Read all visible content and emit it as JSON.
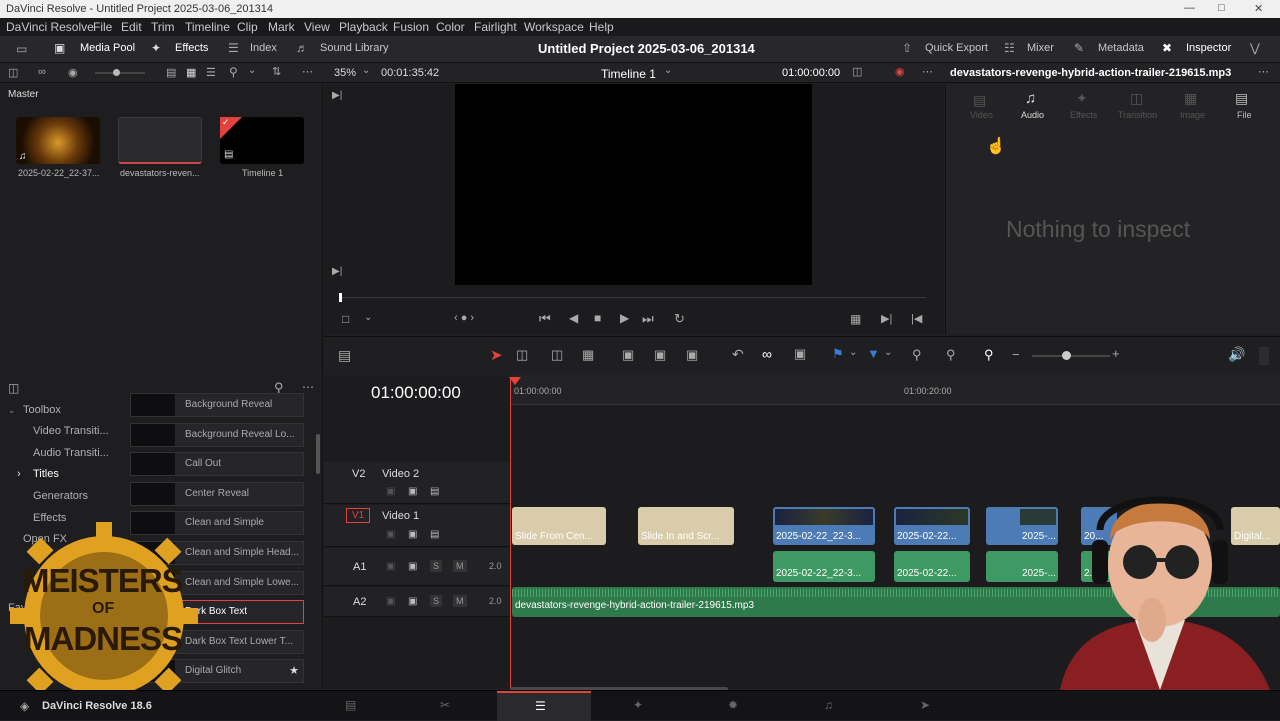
{
  "window": {
    "title": "DaVinci Resolve - Untitled Project 2025-03-06_201314"
  },
  "menu": [
    "DaVinci Resolve",
    "File",
    "Edit",
    "Trim",
    "Timeline",
    "Clip",
    "Mark",
    "View",
    "Playback",
    "Fusion",
    "Color",
    "Fairlight",
    "Workspace",
    "Help"
  ],
  "toolbar": {
    "media_pool": "Media Pool",
    "effects": "Effects",
    "index": "Index",
    "sound_library": "Sound Library",
    "project_title": "Untitled Project 2025-03-06_201314",
    "quick_export": "Quick Export",
    "mixer": "Mixer",
    "metadata": "Metadata",
    "inspector": "Inspector"
  },
  "viewer": {
    "zoom": "35%",
    "duration": "00:01:35:42",
    "timeline_name": "Timeline 1",
    "timecode": "01:00:00:00"
  },
  "media_pool": {
    "bin": "Master",
    "items": [
      {
        "label": "2025-02-22_22-37..."
      },
      {
        "label": "devastators-reven..."
      },
      {
        "label": "Timeline 1"
      }
    ]
  },
  "inspector": {
    "clip_name": "devastators-revenge-hybrid-action-trailer-219615.mp3",
    "tabs": [
      "Video",
      "Audio",
      "Effects",
      "Transition",
      "Image",
      "File"
    ],
    "empty_message": "Nothing to inspect"
  },
  "effects": {
    "tree": [
      "Toolbox",
      "Video Transiti...",
      "Audio Transiti...",
      "Titles",
      "Generators",
      "Effects",
      "Open FX",
      "Fav"
    ],
    "items": [
      {
        "label": "Background Reveal"
      },
      {
        "label": "Background Reveal Lo..."
      },
      {
        "label": "Call Out"
      },
      {
        "label": "Center Reveal"
      },
      {
        "label": "Clean and Simple"
      },
      {
        "label": "Clean and Simple Head..."
      },
      {
        "label": "Clean and Simple Lowe..."
      },
      {
        "label": "Dark Box Text"
      },
      {
        "label": "Dark Box Text Lower T..."
      },
      {
        "label": "Digital Glitch"
      }
    ]
  },
  "timeline": {
    "timecode": "01:00:00:00",
    "ruler": [
      "01:00:00:00",
      "01:00:20:00"
    ],
    "tracks": {
      "v2": {
        "id": "V2",
        "name": "Video 2"
      },
      "v1": {
        "id": "V1",
        "name": "Video 1"
      },
      "a1": {
        "id": "A1",
        "level": "2.0"
      },
      "a2": {
        "id": "A2",
        "level": "2.0"
      }
    },
    "v1_clips": [
      "Slide From Cen...",
      "Slide In and Scr...",
      "2025-02-22_22-3...",
      "2025-02-22...",
      "2025-...",
      "20...",
      "Digital..."
    ],
    "a1_clips": [
      "2025-02-22_22-3...",
      "2025-02-22...",
      "2025-...",
      "2..."
    ],
    "a2_clip": "devastators-revenge-hybrid-action-trailer-219615.mp3",
    "track_buttons": {
      "solo": "S",
      "mute": "M"
    }
  },
  "overlay": {
    "logo_top": "MEISTERS",
    "logo_mid": "OF",
    "logo_bottom": "MADNESS"
  },
  "footer": {
    "app": "DaVinci Resolve 18.6"
  },
  "colors": {
    "accent_red": "#e2413c",
    "clip_beige": "#d8ccab",
    "clip_green": "#3e9a62",
    "clip_blue": "#4d7bb5"
  }
}
